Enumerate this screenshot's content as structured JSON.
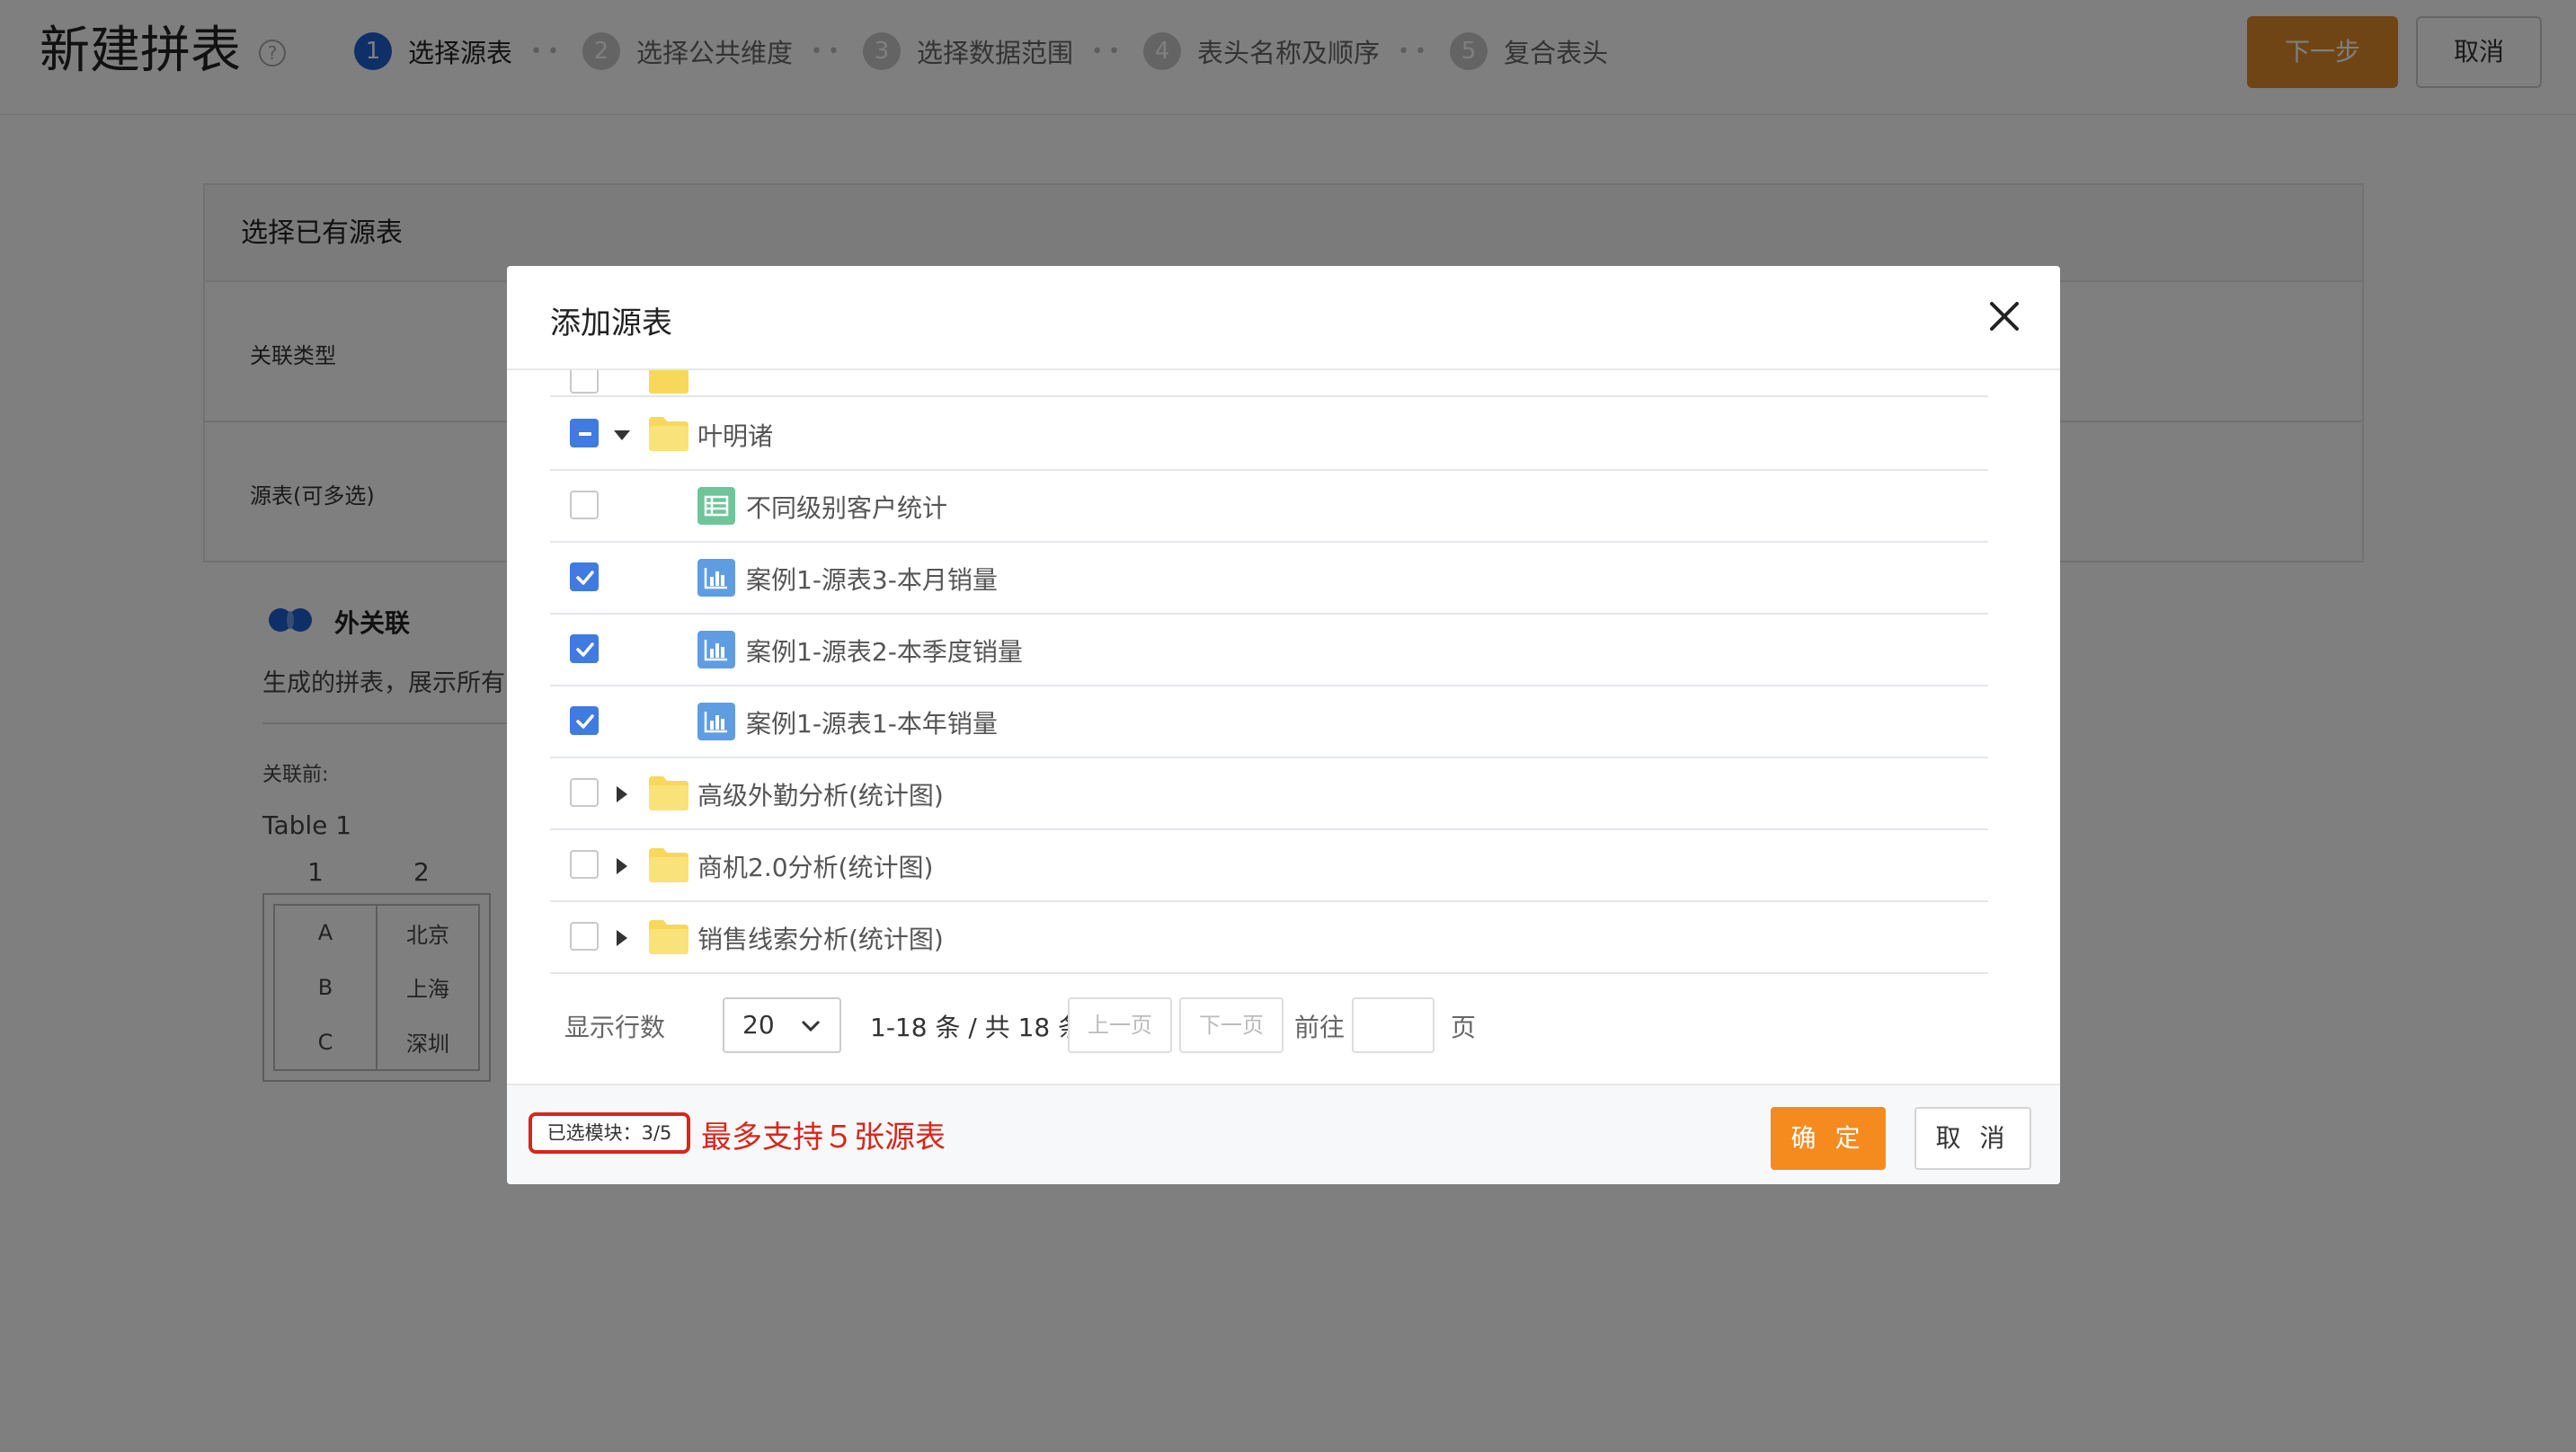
{
  "header": {
    "title": "新建拼表",
    "steps": [
      {
        "num": "1",
        "label": "选择源表"
      },
      {
        "num": "2",
        "label": "选择公共维度"
      },
      {
        "num": "3",
        "label": "选择数据范围"
      },
      {
        "num": "4",
        "label": "表头名称及顺序"
      },
      {
        "num": "5",
        "label": "复合表头"
      }
    ],
    "active_step": 1,
    "next_label": "下一步",
    "cancel_label": "取消"
  },
  "background": {
    "card_title": "选择已有源表",
    "join_type_label": "关联类型",
    "source_label": "源表(可多选)",
    "join_name": "外关联",
    "join_desc": "生成的拼表，展示所有",
    "before_label": "关联前:",
    "table_name": "Table 1",
    "col_headers": [
      "1",
      "2"
    ],
    "table_col1": [
      "A",
      "B",
      "C"
    ],
    "table_col2": [
      "北京",
      "上海",
      "深圳"
    ]
  },
  "modal": {
    "title": "添加源表",
    "rows": [
      {
        "type": "folder",
        "label": "叶明诸",
        "state": "partial",
        "expanded": true
      },
      {
        "type": "table",
        "label": "不同级别客户统计",
        "state": "unchecked",
        "icon": "table-icon"
      },
      {
        "type": "chart",
        "label": "案例1-源表3-本月销量",
        "state": "checked",
        "icon": "bar-chart-icon"
      },
      {
        "type": "chart",
        "label": "案例1-源表2-本季度销量",
        "state": "checked",
        "icon": "bar-chart-icon"
      },
      {
        "type": "chart",
        "label": "案例1-源表1-本年销量",
        "state": "checked",
        "icon": "bar-chart-icon"
      },
      {
        "type": "folder",
        "label": "高级外勤分析(统计图)",
        "state": "unchecked",
        "expanded": false
      },
      {
        "type": "folder",
        "label": "商机2.0分析(统计图)",
        "state": "unchecked",
        "expanded": false
      },
      {
        "type": "folder",
        "label": "销售线索分析(统计图)",
        "state": "unchecked",
        "expanded": false
      }
    ],
    "pager": {
      "rows_label": "显示行数",
      "page_size": "20",
      "range_text": "1-18 条 / 共 18 条",
      "prev_label": "上一页",
      "next_label": "下一页",
      "goto_label": "前往",
      "page_unit": "页"
    },
    "selected_text": "已选模块：3/5",
    "limit_note": "最多支持５张源表",
    "ok_label": "确 定",
    "cancel_label": "取 消"
  },
  "colors": {
    "accent_blue": "#3f7be0",
    "primary_orange": "#f58a1f",
    "warning_red": "#d9261c",
    "folder_yellow": "#f7d85d",
    "table_green": "#6fc59a",
    "chart_blue": "#5f9de3"
  }
}
